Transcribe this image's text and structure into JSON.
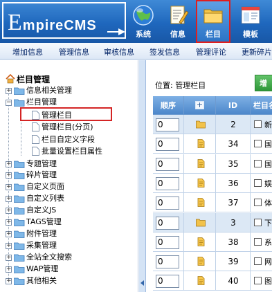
{
  "header": {
    "logo_text_e": "E",
    "logo_text_rest": "mpireCMS",
    "nav": [
      {
        "label": "系统",
        "icon": "globe-icon"
      },
      {
        "label": "信息",
        "icon": "document-edit-icon"
      },
      {
        "label": "栏目",
        "icon": "folder-icon",
        "active": true
      },
      {
        "label": "模板",
        "icon": "window-template-icon"
      }
    ],
    "active_border_color": "#e01e1e"
  },
  "subnav": [
    "增加信息",
    "管理信息",
    "审核信息",
    "签发信息",
    "管理评论",
    "更新碎片"
  ],
  "tree": {
    "title": "栏目管理",
    "nodes": [
      {
        "label": "信息相关管理",
        "expanded": false
      },
      {
        "label": "栏目管理",
        "expanded": true
      },
      {
        "label": "专题管理",
        "expanded": false
      },
      {
        "label": "碎片管理",
        "expanded": false
      },
      {
        "label": "自定义页面",
        "expanded": false
      },
      {
        "label": "自定义列表",
        "expanded": false
      },
      {
        "label": "自定义JS",
        "expanded": false
      },
      {
        "label": "TAGS管理",
        "expanded": false
      },
      {
        "label": "附件管理",
        "expanded": false
      },
      {
        "label": "采集管理",
        "expanded": false
      },
      {
        "label": "全站全文搜索",
        "expanded": false
      },
      {
        "label": "WAP管理",
        "expanded": false
      },
      {
        "label": "其他相关",
        "expanded": false
      }
    ],
    "children": [
      {
        "label": "管理栏目",
        "selected": true
      },
      {
        "label": "管理栏目(分页)"
      },
      {
        "label": "栏目自定义字段"
      },
      {
        "label": "批量设置栏目属性"
      }
    ]
  },
  "main": {
    "location_label": "位置:",
    "location_value": "管理栏目",
    "add_button": "增",
    "columns": [
      "顺序",
      "+",
      "ID",
      "栏目名"
    ],
    "rows": [
      {
        "order": "0",
        "kind": "folder",
        "id": "2",
        "tail": "新"
      },
      {
        "order": "0",
        "kind": "page",
        "id": "34",
        "tail": "国"
      },
      {
        "order": "0",
        "kind": "page",
        "id": "35",
        "tail": "国"
      },
      {
        "order": "0",
        "kind": "page",
        "id": "36",
        "tail": "娱"
      },
      {
        "order": "0",
        "kind": "page",
        "id": "37",
        "tail": "体"
      },
      {
        "order": "0",
        "kind": "folder",
        "id": "3",
        "tail": "下"
      },
      {
        "order": "0",
        "kind": "page",
        "id": "38",
        "tail": "系"
      },
      {
        "order": "0",
        "kind": "page",
        "id": "39",
        "tail": "网"
      },
      {
        "order": "0",
        "kind": "page",
        "id": "40",
        "tail": "图"
      }
    ]
  }
}
